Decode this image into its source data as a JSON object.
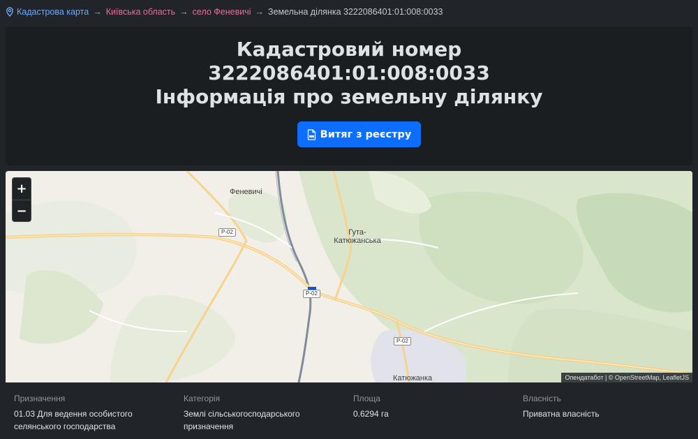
{
  "breadcrumb": {
    "home": "Кадастрова карта",
    "region": "Київська область",
    "village": "село Феневичі",
    "current": "Земельна ділянка 3222086401:01:008:0033",
    "separator": "→"
  },
  "hero": {
    "title_line1": "Кадастровий номер",
    "title_line2": "3222086401:01:008:0033",
    "title_line3": "Інформація про земельну ділянку",
    "button_label": "Витяг з реєстру",
    "button_color": "#0d6efd"
  },
  "map": {
    "zoom_in": "+",
    "zoom_out": "−",
    "labels": {
      "fenevychi": "Феневичі",
      "huta_1": "Гута-",
      "huta_2": "Катюжанська",
      "katiuzhanka": "Катюжанка"
    },
    "road_shields": {
      "r1": "Р-02",
      "r2": "Р-02",
      "r3": "Р-02"
    },
    "attribution": "Опендатабот | © OpenStreetMap, LeafletJS",
    "parcel_color": "#1456c8"
  },
  "info": {
    "purpose_label": "Призначення",
    "purpose_value": "01.03 Для ведення особистого селянського господарства",
    "category_label": "Категорія",
    "category_value": "Землі сільськогосподарського призначення",
    "area_label": "Площа",
    "area_value": "0.6294 га",
    "ownership_label": "Власність",
    "ownership_value": "Приватна власність"
  }
}
